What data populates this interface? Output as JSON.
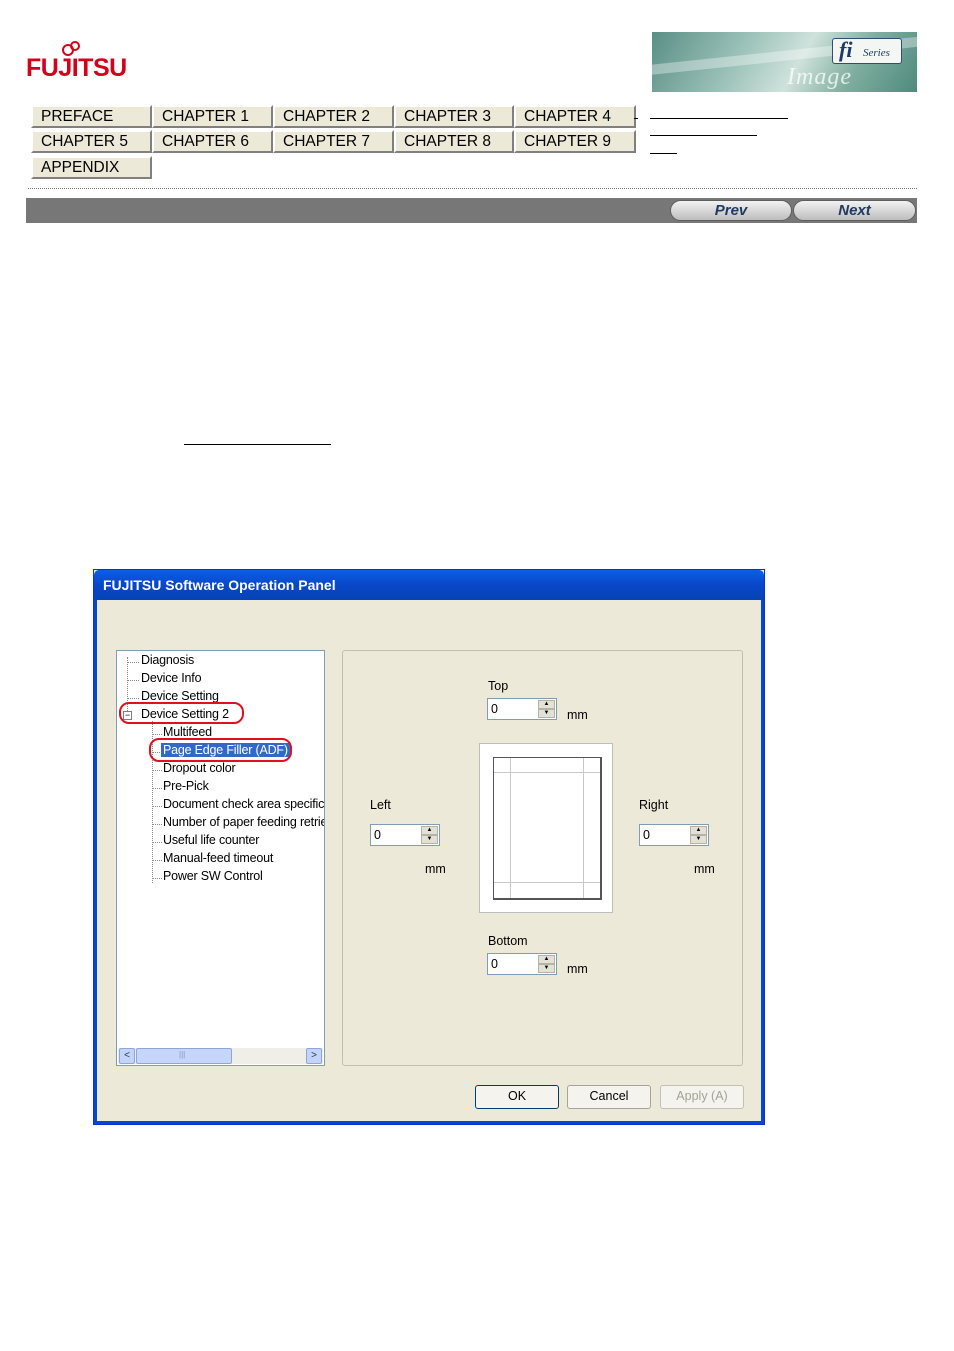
{
  "header": {
    "brand": "FUJITSU",
    "banner_fi": "fi",
    "banner_series": "Series",
    "banner_script": "Image Scanner"
  },
  "nav": {
    "row1": [
      "PREFACE",
      "CHAPTER 1",
      "CHAPTER 2",
      "CHAPTER 3",
      "CHAPTER 4"
    ],
    "row2": [
      "CHAPTER 5",
      "CHAPTER 6",
      "CHAPTER 7",
      "CHAPTER 8",
      "CHAPTER 9"
    ],
    "row3": [
      "APPENDIX"
    ]
  },
  "pager": {
    "prev": "Prev",
    "next": "Next"
  },
  "dialog": {
    "title": "FUJITSU Software Operation Panel",
    "tree": {
      "items": [
        "Diagnosis",
        "Device Info",
        "Device Setting",
        "Device Setting 2",
        "Multifeed",
        "Page Edge Filler (ADF)",
        "Dropout color",
        "Pre-Pick",
        "Document check area specific",
        "Number of paper feeding retrie",
        "Useful life counter",
        "Manual-feed timeout",
        "Power SW Control"
      ],
      "expander": "−",
      "selected": "Page Edge Filler (ADF)"
    },
    "scroll": {
      "left_arrow": "<",
      "right_arrow": ">",
      "grip": "|||"
    },
    "settings": {
      "top_label": "Top",
      "bottom_label": "Bottom",
      "left_label": "Left",
      "right_label": "Right",
      "unit": "mm",
      "top_value": "0",
      "bottom_value": "0",
      "left_value": "0",
      "right_value": "0"
    },
    "buttons": {
      "ok": "OK",
      "cancel": "Cancel",
      "apply": "Apply (A)"
    }
  },
  "colors": {
    "brand_red": "#d4001a",
    "titlebar_blue": "#0a5fe6",
    "highlight_ring": "#e01020",
    "selection": "#316ac5"
  }
}
